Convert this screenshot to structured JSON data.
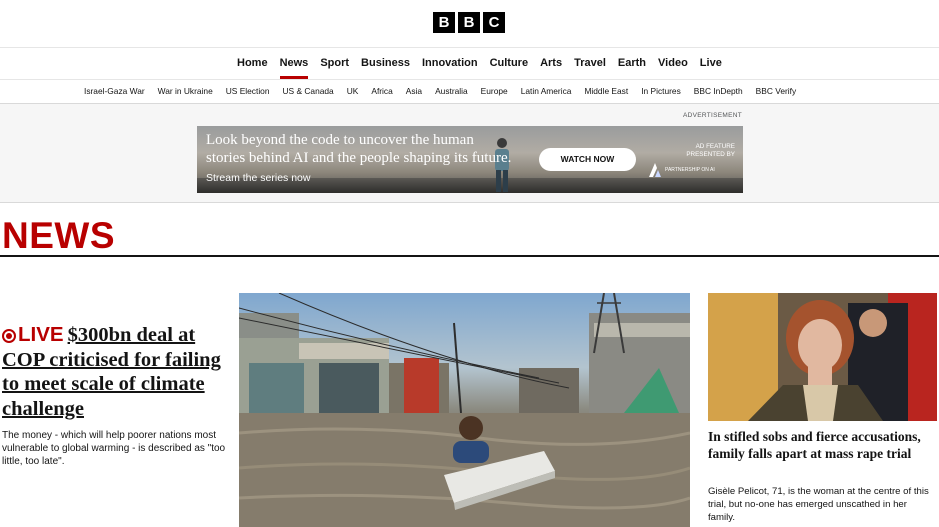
{
  "brand": {
    "letters": [
      "B",
      "B",
      "C"
    ]
  },
  "main_nav": [
    {
      "label": "Home",
      "active": false
    },
    {
      "label": "News",
      "active": true
    },
    {
      "label": "Sport",
      "active": false
    },
    {
      "label": "Business",
      "active": false
    },
    {
      "label": "Innovation",
      "active": false
    },
    {
      "label": "Culture",
      "active": false
    },
    {
      "label": "Arts",
      "active": false
    },
    {
      "label": "Travel",
      "active": false
    },
    {
      "label": "Earth",
      "active": false
    },
    {
      "label": "Video",
      "active": false
    },
    {
      "label": "Live",
      "active": false
    }
  ],
  "sub_nav": [
    "Israel-Gaza War",
    "War in Ukraine",
    "US Election",
    "US & Canada",
    "UK",
    "Africa",
    "Asia",
    "Australia",
    "Europe",
    "Latin America",
    "Middle East",
    "In Pictures",
    "BBC InDepth",
    "BBC Verify"
  ],
  "ad": {
    "label": "ADVERTISEMENT",
    "headline_line1": "Look beyond the code to uncover the human",
    "headline_line2": "stories behind AI and the people shaping its future.",
    "subline": "Stream the series now",
    "cta": "WATCH NOW",
    "feature_line1": "AD FEATURE",
    "feature_line2": "PRESENTED BY",
    "partner": "PARTNERSHIP ON AI"
  },
  "section_title": "NEWS",
  "lead_story": {
    "live_label": "LIVE",
    "headline": "$300bn deal at COP criticised for failing to meet scale of climate challenge",
    "description": "The money - which will help poorer nations most vulnerable to global warming - is described as \"too little, too late\"."
  },
  "side_story": {
    "headline": "In stifled sobs and fierce accusations, family falls apart at mass rape trial",
    "description": "Gisèle Pelicot, 71, is the woman at the centre of this trial, but no-one has emerged unscathed in her family."
  },
  "colors": {
    "accent": "#b80000",
    "text": "#141414",
    "ad_background": "#f6f6f6"
  }
}
